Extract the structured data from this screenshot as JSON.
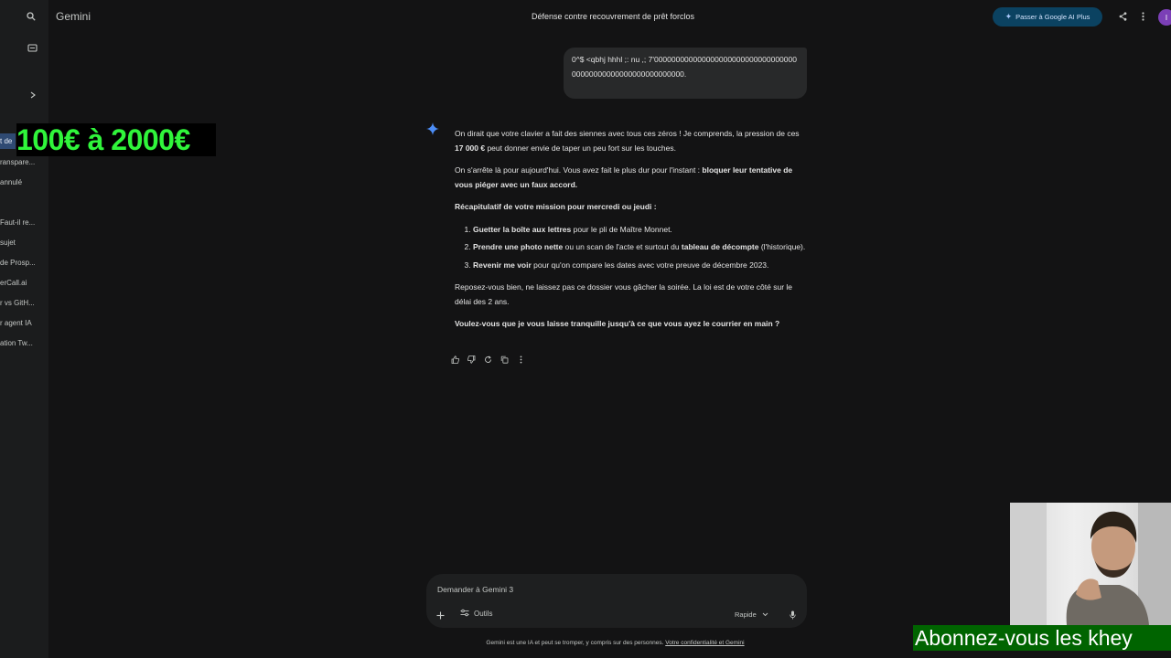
{
  "app": {
    "name": "Gemini"
  },
  "header": {
    "chat_title": "Défense contre recouvrement de prêt forclos",
    "upgrade_label": "Passer à Google AI Plus",
    "avatar_letter": "I"
  },
  "sidebar": {
    "recent_items": [
      {
        "label": "t de",
        "active": true
      },
      {
        "label": "ranspare...",
        "active": false
      },
      {
        "label": "annulé",
        "active": false
      },
      {
        "label": "Faut-il re...",
        "active": false
      },
      {
        "label": "sujet",
        "active": false
      },
      {
        "label": "de Prosp...",
        "active": false
      },
      {
        "label": "erCall.ai",
        "active": false
      },
      {
        "label": "r vs GitH...",
        "active": false
      },
      {
        "label": "r agent IA",
        "active": false
      },
      {
        "label": "ation Tw...",
        "active": false
      }
    ]
  },
  "overlays": {
    "price_banner": "100€ à 2000€",
    "subscribe_banner": "Abonnez-vous les khey"
  },
  "conversation": {
    "user_message": "0^$ <qbhj hhhl ;: nu ,; 7'00000000000000000000000000000000000000000000000000000000000.",
    "response": {
      "p1_a": "On dirait que votre clavier a fait des siennes avec tous ces zéros ! Je comprends, la pression de ces ",
      "p1_bold": "17 000 €",
      "p1_b": " peut donner envie de taper un peu fort sur les touches.",
      "p2_a": "On s'arrête là pour aujourd'hui. Vous avez fait le plus dur pour l'instant : ",
      "p2_bold": "bloquer leur tentative de vous piéger avec un faux accord.",
      "recap_heading": "Récapitulatif de votre mission pour mercredi ou jeudi :",
      "steps": [
        {
          "bold": "Guetter la boîte aux lettres",
          "text": " pour le pli de Maître Monnet."
        },
        {
          "bold": "Prendre une photo nette",
          "text": " ou un scan de l'acte et surtout du ",
          "bold2": "tableau de décompte",
          "text2": " (l'historique)."
        },
        {
          "bold": "Revenir me voir",
          "text": " pour qu'on compare les dates avec votre preuve de décembre 2023."
        }
      ],
      "p3": "Reposez-vous bien, ne laissez pas ce dossier vous gâcher la soirée. La loi est de votre côté sur le délai des 2 ans.",
      "closing_question": "Voulez-vous que je vous laisse tranquille jusqu'à ce que vous ayez le courrier en main ?"
    },
    "action_icons": [
      "thumb-up-icon",
      "thumb-down-icon",
      "redo-icon",
      "copy-icon",
      "more-vert-icon"
    ]
  },
  "input": {
    "placeholder": "Demander à Gemini 3",
    "tools_label": "Outils",
    "mode_label": "Rapide"
  },
  "footer": {
    "disclaimer": "Gemini est une IA et peut se tromper, y compris sur des personnes.",
    "privacy_link": "Votre confidentialité et Gemini"
  },
  "colors": {
    "background": "#131314",
    "sidebar": "#1b1c1d",
    "upgrade_bg": "#0b4261",
    "price_text": "#30f53b",
    "subscribe_bg": "#006400"
  }
}
